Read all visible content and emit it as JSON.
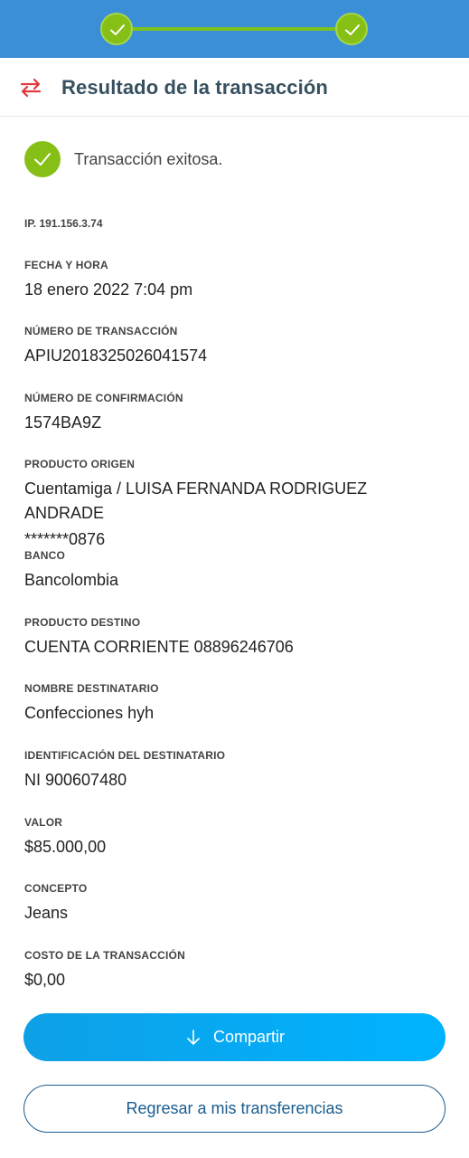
{
  "stepper": {
    "steps": [
      "done",
      "done"
    ],
    "accent_color": "#86bf16",
    "bar_color": "#3b8fd6"
  },
  "header": {
    "icon": "transfer-arrows-icon",
    "title": "Resultado de la transacción"
  },
  "status": {
    "icon": "check-circle-icon",
    "message": "Transacción exitosa."
  },
  "ip": "IP. 191.156.3.74",
  "fields": [
    {
      "label": "FECHA Y HORA",
      "value": "18 enero 2022 7:04 pm"
    },
    {
      "label": "NÚMERO DE TRANSACCIÓN",
      "value": "APIU2018325026041574"
    },
    {
      "label": "NÚMERO DE CONFIRMACIÓN",
      "value": "1574BA9Z"
    },
    {
      "label": "PRODUCTO ORIGEN",
      "value": "Cuentamiga / LUISA FERNANDA RODRIGUEZ ANDRADE",
      "value2": "*******0876"
    },
    {
      "label": "BANCO",
      "value": "Bancolombia"
    },
    {
      "label": "PRODUCTO DESTINO",
      "value": "CUENTA CORRIENTE 08896246706"
    },
    {
      "label": "NOMBRE DESTINATARIO",
      "value": "Confecciones hyh"
    },
    {
      "label": "IDENTIFICACIÓN DEL DESTINATARIO",
      "value": "NI 900607480"
    },
    {
      "label": "VALOR",
      "value": "$85.000,00"
    },
    {
      "label": "CONCEPTO",
      "value": "Jeans"
    },
    {
      "label": "COSTO DE LA TRANSACCIÓN",
      "value": "$0,00"
    }
  ],
  "actions": {
    "share_icon": "download-arrow-icon",
    "share_label": "Compartir",
    "back_label": "Regresar a mis transferencias"
  }
}
